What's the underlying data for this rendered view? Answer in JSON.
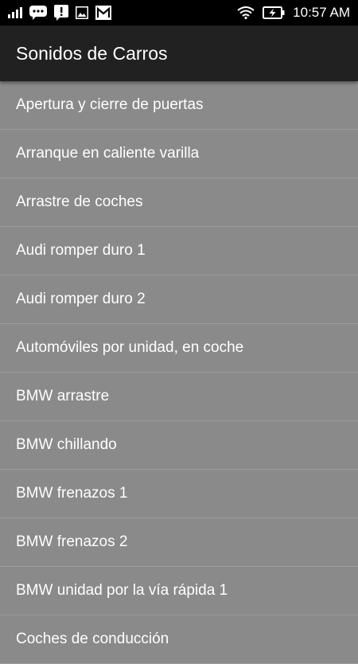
{
  "status_bar": {
    "time": "10:57 AM",
    "icons": [
      "signal-icon",
      "chat-icon",
      "alert-icon",
      "image-icon",
      "gmail-icon",
      "wifi-icon",
      "battery-charging-icon"
    ]
  },
  "app_bar": {
    "title": "Sonidos de Carros"
  },
  "list": {
    "items": [
      {
        "label": "Apertura y cierre de puertas"
      },
      {
        "label": "Arranque en caliente varilla"
      },
      {
        "label": "Arrastre de coches"
      },
      {
        "label": "Audi romper duro 1"
      },
      {
        "label": "Audi romper duro 2"
      },
      {
        "label": "Automóviles por unidad, en coche"
      },
      {
        "label": "BMW arrastre"
      },
      {
        "label": "BMW chillando"
      },
      {
        "label": "BMW frenazos 1"
      },
      {
        "label": "BMW frenazos 2"
      },
      {
        "label": "BMW unidad por la vía rápida 1"
      },
      {
        "label": "Coches de conducción"
      }
    ]
  },
  "colors": {
    "status_bar": "#000000",
    "app_bar": "#212121",
    "list_background": "#8a8a8a",
    "divider": "#9b9b9b",
    "text": "#ffffff"
  }
}
